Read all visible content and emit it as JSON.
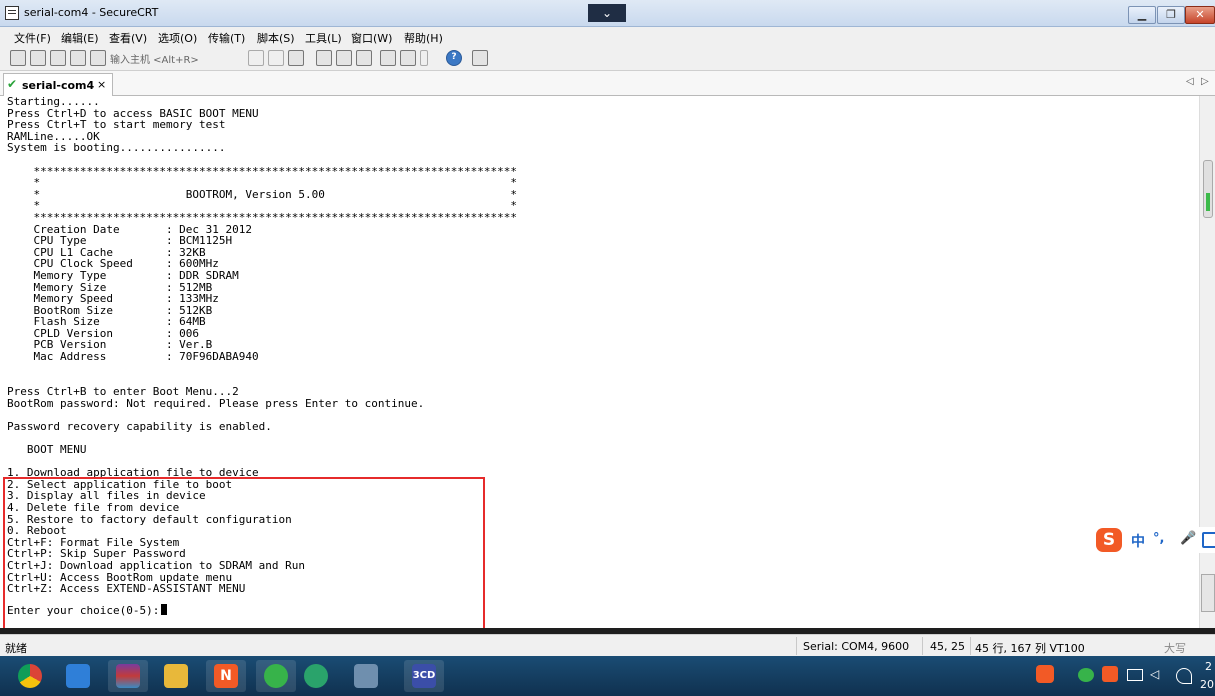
{
  "window": {
    "title": "serial-com4 - SecureCRT",
    "dropdown_glyph": "⌄",
    "minimize": "▁",
    "maximize": "❐",
    "close": "✕"
  },
  "menu": [
    "文件(F)",
    "编辑(E)",
    "查看(V)",
    "选项(O)",
    "传输(T)",
    "脚本(S)",
    "工具(L)",
    "窗口(W)",
    "帮助(H)"
  ],
  "toolbar": {
    "connect_placeholder": "输入主机 <Alt+R>",
    "help_glyph": "?"
  },
  "tab": {
    "label": "serial-com4",
    "check_glyph": "✔",
    "close_glyph": "×",
    "scroll_left": "◁",
    "scroll_right": "▷"
  },
  "terminal": {
    "output_top": "Starting......\nPress Ctrl+D to access BASIC BOOT MENU\nPress Ctrl+T to start memory test\nRAMLine.....OK\nSystem is booting................\n\n    *************************************************************************\n    *                                                                       *\n    *                      BOOTROM, Version 5.00                            *\n    *                                                                       *\n    *************************************************************************\n    Creation Date       : Dec 31 2012\n    CPU Type            : BCM1125H\n    CPU L1 Cache        : 32KB\n    CPU Clock Speed     : 600MHz\n    Memory Type         : DDR SDRAM\n    Memory Size         : 512MB\n    Memory Speed        : 133MHz\n    BootRom Size        : 512KB\n    Flash Size          : 64MB\n    CPLD Version        : 006\n    PCB Version         : Ver.B\n    Mac Address         : 70F96DABA940",
    "output_menu": "Press Ctrl+B to enter Boot Menu...2\nBootRom password: Not required. Please press Enter to continue.\n\nPassword recovery capability is enabled.\n\n   BOOT MENU\n\n1. Download application file to device\n2. Select application file to boot\n3. Display all files in device\n4. Delete file from device\n5. Restore to factory default configuration\n0. Reboot\nCtrl+F: Format File System\nCtrl+P: Skip Super Password\nCtrl+J: Download application to SDRAM and Run\nCtrl+U: Access BootRom update menu\nCtrl+Z: Access EXTEND-ASSISTANT MENU",
    "prompt": "Enter your choice(0-5):"
  },
  "status": {
    "ready": "就绪",
    "connection": "Serial: COM4, 9600",
    "cursor_pos": "45,  25",
    "size": "45 行, 167 列 VT100",
    "caps": "大写"
  },
  "ime": {
    "logo": "S",
    "lang": "中",
    "punct": "°,",
    "mic": "🎤"
  },
  "taskbar": {
    "apps": [
      "chrome-icon",
      "qq-browser-icon",
      "winrar-icon",
      "folder-icon",
      "app-n-icon",
      "wechat-icon",
      "edge-icon",
      "app-square-icon",
      "3cd-icon"
    ],
    "app_3cd_label": "3CD",
    "app_n_label": "N",
    "clock_line1": "2",
    "clock_line2": "20"
  },
  "colors": {
    "highlight_border": "#e62b2b",
    "accent_orange": "#f25a26",
    "ime_blue": "#1f66c7"
  }
}
